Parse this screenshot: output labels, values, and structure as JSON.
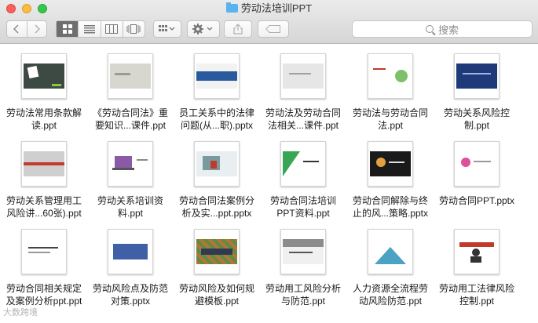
{
  "window": {
    "title": "劳动法培训PPT"
  },
  "toolbar": {
    "back_icon": "chevron-left-icon",
    "forward_icon": "chevron-right-icon",
    "view_modes": [
      "icon-view-icon",
      "list-view-icon",
      "column-view-icon",
      "cover-flow-icon"
    ],
    "arrange_icon": "arrange-grid-icon",
    "action_icon": "gear-icon",
    "share_icon": "share-icon",
    "tag_icon": "tag-icon",
    "search_placeholder": "搜索"
  },
  "files": [
    {
      "name": "劳动法常用条款解读.ppt",
      "line1": "劳动法常用条款解",
      "line2": "读.ppt",
      "thumb": "dark-green"
    },
    {
      "name": "《劳动合同法》重要知识...课件.ppt",
      "line1": "《劳动合同法》重",
      "line2": "要知识...课件.ppt",
      "thumb": "gray"
    },
    {
      "name": "员工关系中的法律问题(从...职).pptx",
      "line1": "员工关系中的法律",
      "line2": "问题(从...职).pptx",
      "thumb": "blue-stripe"
    },
    {
      "name": "劳动法及劳动合同法相关...课件.ppt",
      "line1": "劳动法及劳动合同",
      "line2": "法相关...课件.ppt",
      "thumb": "light-gray"
    },
    {
      "name": "劳动法与劳动合同法.ppt",
      "line1": "劳动法与劳动合同",
      "line2": "法.ppt",
      "thumb": "white-green"
    },
    {
      "name": "劳动关系风险控制.ppt",
      "line1": "劳动关系风险控",
      "line2": "制.ppt",
      "thumb": "navy"
    },
    {
      "name": "劳动关系管理用工风险讲...60张).ppt",
      "line1": "劳动关系管理用工",
      "line2": "风险讲...60张).ppt",
      "thumb": "gray-red"
    },
    {
      "name": "劳动关系培训资料.ppt",
      "line1": "劳动关系培训资",
      "line2": "料.ppt",
      "thumb": "laptop"
    },
    {
      "name": "劳动合同法案例分析及实...ppt.pptx",
      "line1": "劳动合同法案例分",
      "line2": "析及实...ppt.pptx",
      "thumb": "photo"
    },
    {
      "name": "劳动合同法培训PPT资料.ppt",
      "line1": "劳动合同法培训",
      "line2": "PPT资料.ppt",
      "thumb": "green-tri"
    },
    {
      "name": "劳动合同解除与终止的风...策略.pptx",
      "line1": "劳动合同解除与终",
      "line2": "止的风...策略.pptx",
      "thumb": "black"
    },
    {
      "name": "劳动合同PPT.pptx",
      "line1": "劳动合同PPT.pptx",
      "line2": "",
      "thumb": "pink"
    },
    {
      "name": "劳动合同相关规定及案例分析ppt.ppt",
      "line1": "劳动合同相关规定",
      "line2": "及案例分析ppt.ppt",
      "thumb": "white-text"
    },
    {
      "name": "劳动风险点及防范对策.pptx",
      "line1": "劳动风险点及防范",
      "line2": "对策.pptx",
      "thumb": "blue-block"
    },
    {
      "name": "劳动风险及如何规避模板.ppt",
      "line1": "劳动风险及如何规",
      "line2": "避模板.ppt",
      "thumb": "zigzag"
    },
    {
      "name": "劳动用工风险分析与防范.ppt",
      "line1": "劳动用工风险分析",
      "line2": "与防范.ppt",
      "thumb": "gray-bar"
    },
    {
      "name": "人力资源全流程劳动风险防范.ppt",
      "line1": "人力资源全流程劳",
      "line2": "动风险防范.ppt",
      "thumb": "teal-tri"
    },
    {
      "name": "劳动用工法律风险控制.ppt",
      "line1": "劳动用工法律风险",
      "line2": "控制.ppt",
      "thumb": "red-figure"
    }
  ],
  "watermark": "大数跨境"
}
